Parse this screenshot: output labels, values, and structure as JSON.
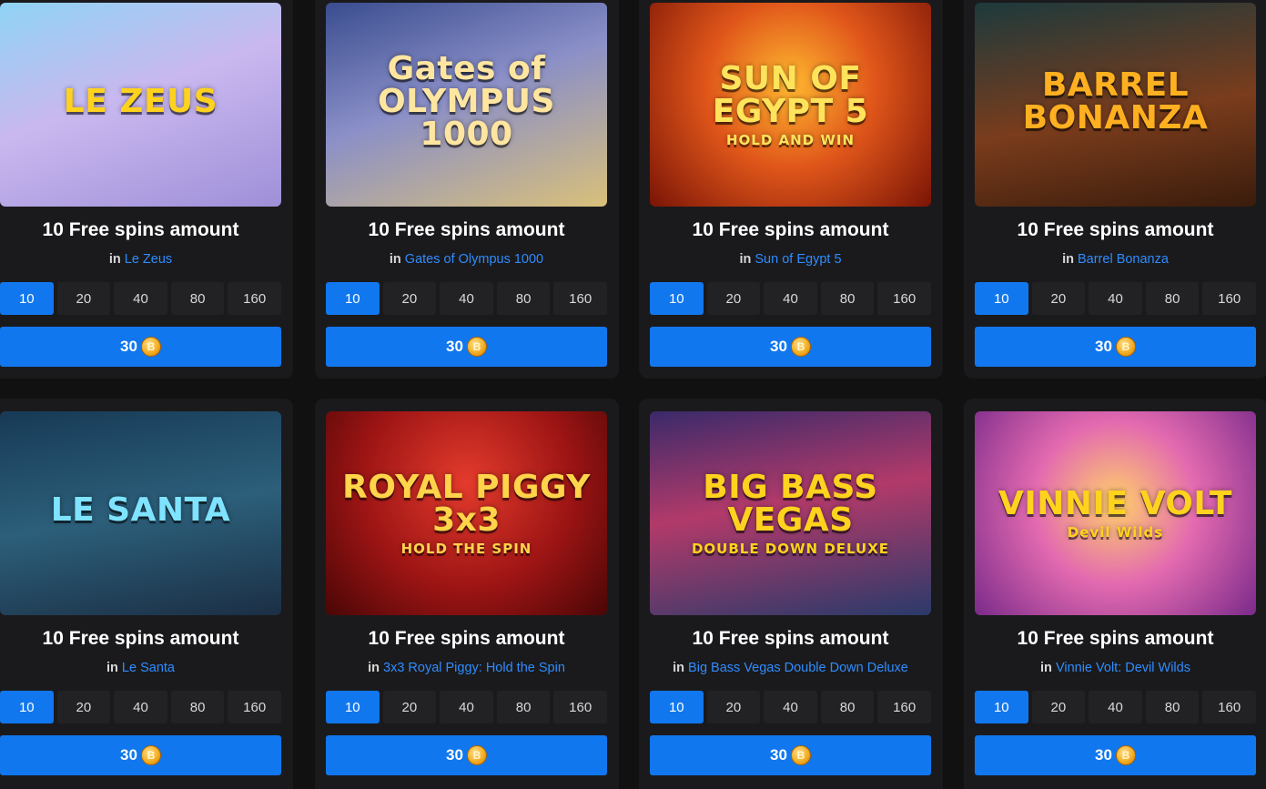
{
  "amount_options": [
    "10",
    "20",
    "40",
    "80",
    "160"
  ],
  "cards": [
    {
      "heading": "10 Free spins amount",
      "in": "in",
      "game": "Le Zeus",
      "thumb_title": "LE ZEUS",
      "thumb_sub": "",
      "price": "30",
      "bg": "linear-gradient(160deg,#8fd3f4 0%,#c9b8ef 45%,#9f8fd8 100%)",
      "fg": "#ffd21e"
    },
    {
      "heading": "10 Free spins amount",
      "in": "in",
      "game": "Gates of Olympus 1000",
      "thumb_title": "Gates of OLYMPUS 1000",
      "thumb_sub": "",
      "price": "30",
      "bg": "linear-gradient(160deg,#3a4d8f 0%,#8a8fc8 45%,#d9c07a 100%)",
      "fg": "#ffe6a0"
    },
    {
      "heading": "10 Free spins amount",
      "in": "in",
      "game": "Sun of Egypt 5",
      "thumb_title": "SUN OF EGYPT 5",
      "thumb_sub": "HOLD AND WIN",
      "price": "30",
      "bg": "radial-gradient(circle at 50% 40%,#ffb830 0%,#e0561a 45%,#7a1406 100%)",
      "fg": "#ffe35a"
    },
    {
      "heading": "10 Free spins amount",
      "in": "in",
      "game": "Barrel Bonanza",
      "thumb_title": "BARREL BONANZA",
      "thumb_sub": "",
      "price": "30",
      "bg": "linear-gradient(170deg,#1d3a3c 0%,#7a3c1c 55%,#3a1c0c 100%)",
      "fg": "#ffb020"
    },
    {
      "heading": "10 Free spins amount",
      "in": "in",
      "game": "Le Santa",
      "thumb_title": "LE SANTA",
      "thumb_sub": "",
      "price": "30",
      "bg": "linear-gradient(170deg,#173a56 0%,#2c5f7a 50%,#1b2f45 100%)",
      "fg": "#7fe3ff"
    },
    {
      "heading": "10 Free spins amount",
      "in": "in",
      "game": "3x3 Royal Piggy: Hold the Spin",
      "thumb_title": "ROYAL PIGGY 3x3",
      "thumb_sub": "HOLD THE SPIN",
      "price": "30",
      "bg": "radial-gradient(circle at 50% 35%,#e43b2c 0%,#9c1414 55%,#4a0606 100%)",
      "fg": "#ffd34a"
    },
    {
      "heading": "10 Free spins amount",
      "in": "in",
      "game": "Big Bass Vegas Double Down Deluxe",
      "thumb_title": "BIG BASS VEGAS",
      "thumb_sub": "DOUBLE DOWN DELUXE",
      "price": "30",
      "bg": "linear-gradient(170deg,#3a2a6a 0%,#b23a6a 45%,#2a3a6a 100%)",
      "fg": "#ffd21e"
    },
    {
      "heading": "10 Free spins amount",
      "in": "in",
      "game": "Vinnie Volt: Devil Wilds",
      "thumb_title": "VINNIE VOLT",
      "thumb_sub": "Devil Wilds",
      "price": "30",
      "bg": "radial-gradient(circle at 50% 45%,#ffcf6a 0%,#e36ab0 45%,#7a2a8a 100%)",
      "fg": "#ffd21e"
    }
  ]
}
